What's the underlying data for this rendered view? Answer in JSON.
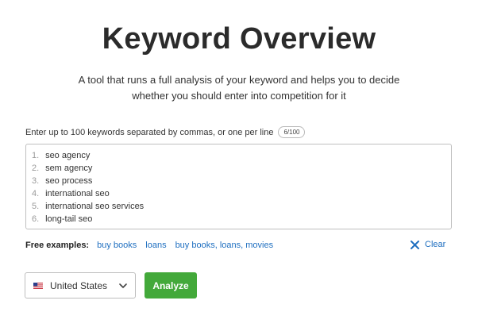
{
  "header": {
    "title": "Keyword Overview",
    "subtitle_line1": "A tool that runs a full analysis of your keyword and helps you to decide",
    "subtitle_line2": "whether you should enter into competition for it"
  },
  "keywords": {
    "label": "Enter up to 100 keywords separated by commas, or one per line",
    "counter": "6/100",
    "items": [
      {
        "num": "1.",
        "text": "seo agency"
      },
      {
        "num": "2.",
        "text": "sem agency"
      },
      {
        "num": "3.",
        "text": "seo process"
      },
      {
        "num": "4.",
        "text": "international seo"
      },
      {
        "num": "5.",
        "text": "international seo services"
      },
      {
        "num": "6.",
        "text": "long-tail seo"
      }
    ]
  },
  "examples": {
    "label": "Free examples:",
    "links": [
      "buy books",
      "loans",
      "buy books, loans, movies"
    ],
    "clear_label": "Clear"
  },
  "controls": {
    "country": "United States",
    "country_icon": "us-flag-icon",
    "analyze_label": "Analyze"
  },
  "colors": {
    "link": "#1f6fc0",
    "analyze_button": "#43a93a"
  }
}
